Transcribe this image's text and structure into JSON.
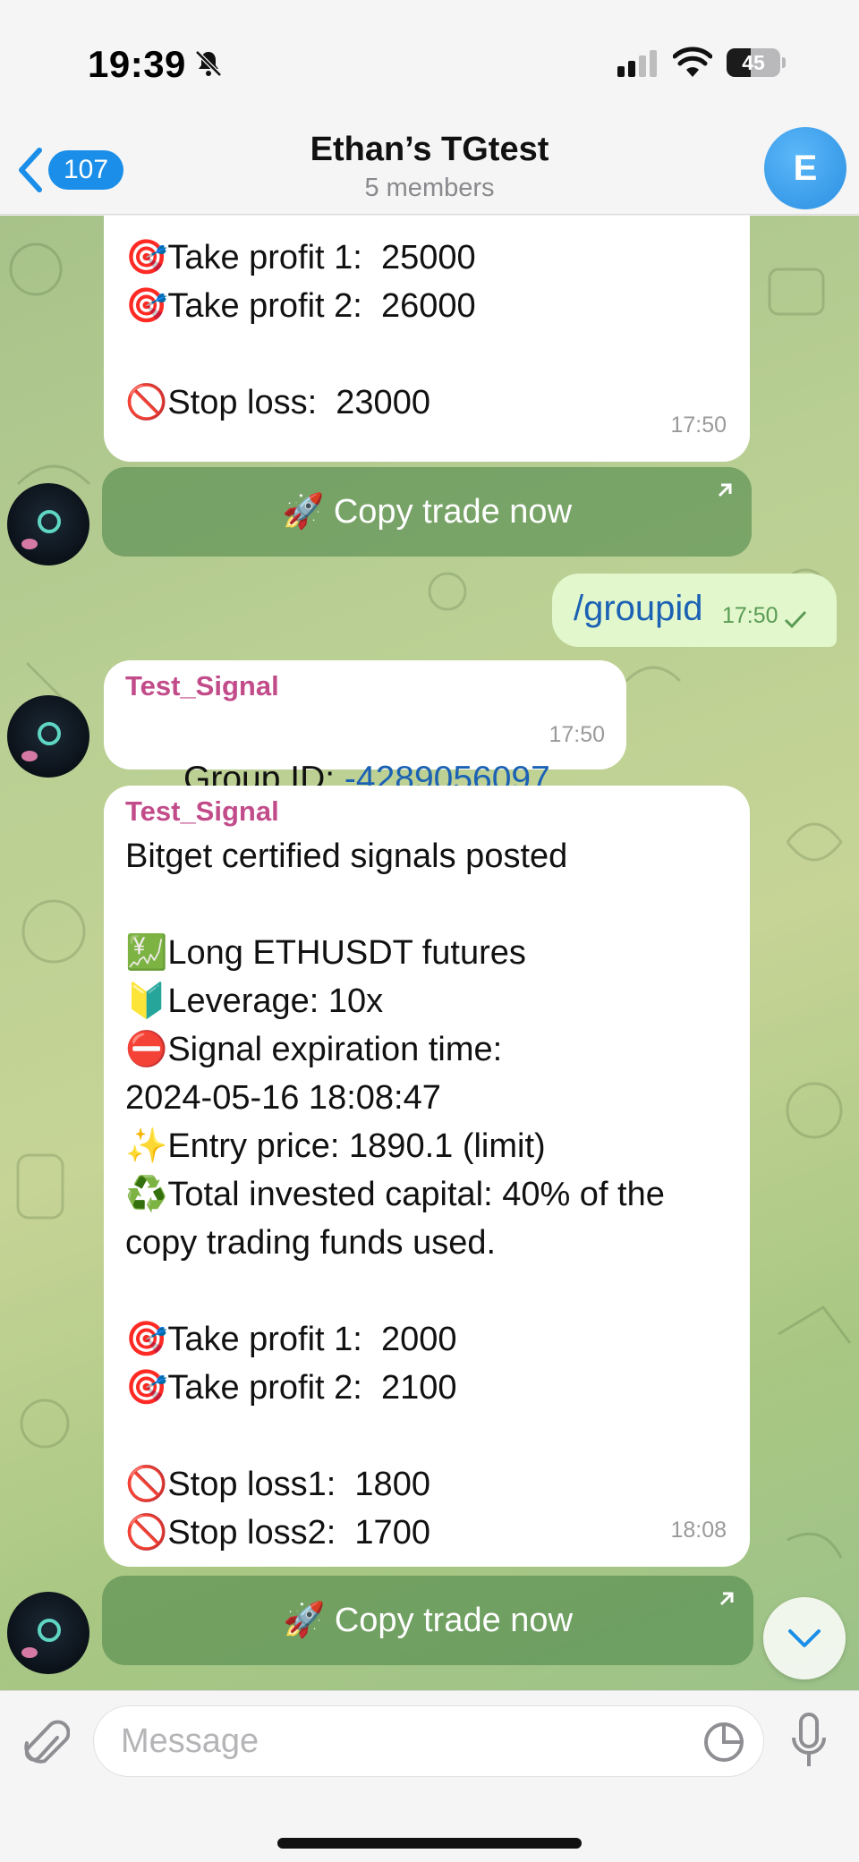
{
  "status_bar": {
    "time": "19:39",
    "battery_level": "45",
    "battery_fraction": 0.45,
    "icons": [
      "bell-slash-icon",
      "cellular-signal-icon",
      "wifi-icon",
      "battery-icon"
    ]
  },
  "header": {
    "back_badge": "107",
    "title": "Ethan’s TGtest",
    "subtitle": "5 members",
    "avatar_letter": "E",
    "accent_color": "#1a8ee8"
  },
  "messages": {
    "signal1": {
      "lines": [
        "🎯Take profit 1:  25000",
        "🎯Take profit 2:  26000",
        "",
        "🚫Stop loss:  23000"
      ],
      "time": "17:50",
      "button": "🚀 Copy trade now"
    },
    "outgoing": {
      "text": "/groupid",
      "time": "17:50"
    },
    "group_id": {
      "sender": "Test_Signal",
      "prefix": "Group ID: ",
      "id": "-4289056097",
      "time": "17:50"
    },
    "signal2": {
      "sender": "Test_Signal",
      "lines": [
        "Bitget certified signals posted",
        "",
        "💹Long ETHUSDT futures",
        "🔰Leverage: 10x",
        "⛔Signal expiration time:",
        "2024-05-16 18:08:47",
        "✨Entry price: 1890.1 (limit)",
        "♻️Total invested capital: 40% of the",
        "copy trading funds used.",
        "",
        "🎯Take profit 1:  2000",
        "🎯Take profit 2:  2100",
        "",
        "🚫Stop loss1:  1800",
        "🚫Stop loss2:  1700"
      ],
      "time": "18:08",
      "button": "🚀 Copy trade now"
    }
  },
  "input": {
    "placeholder": "Message"
  },
  "colors": {
    "sender_name": "#c24b8a",
    "link": "#1b62b5",
    "outgoing_bubble": "#e2f7cb"
  }
}
